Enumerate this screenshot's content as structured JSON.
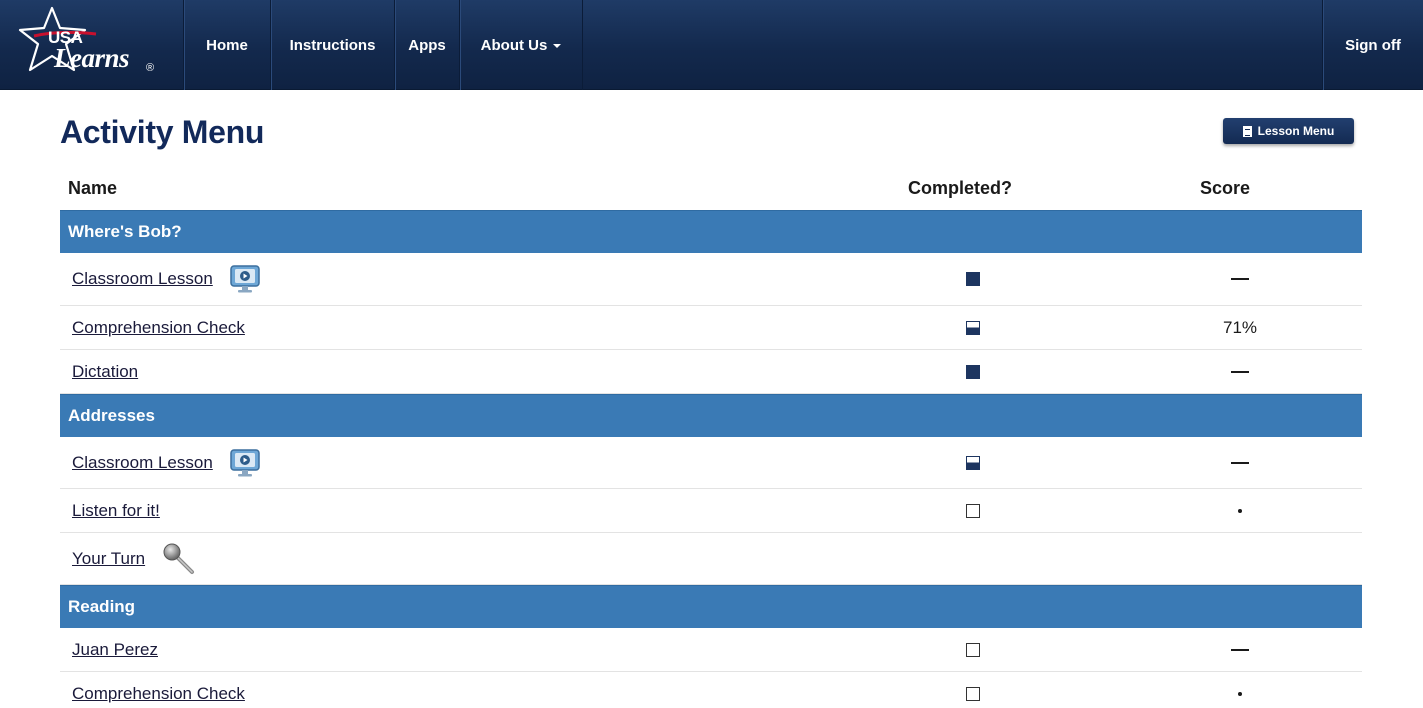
{
  "nav": {
    "logo_top": "USA",
    "logo_bottom": "Learns",
    "logo_reg": "®",
    "items": [
      {
        "label": "Home"
      },
      {
        "label": "Instructions"
      },
      {
        "label": "Apps"
      },
      {
        "label": "About Us"
      }
    ],
    "sign_off": "Sign off"
  },
  "page": {
    "title": "Activity Menu",
    "lesson_menu_button": "Lesson Menu"
  },
  "table": {
    "headers": {
      "name": "Name",
      "completed": "Completed?",
      "score": "Score"
    },
    "sections": [
      {
        "title": "Where's Bob?",
        "rows": [
          {
            "name": "Classroom Lesson",
            "icon": "video-lesson-icon",
            "completed": "full",
            "score": "—"
          },
          {
            "name": "Comprehension Check",
            "icon": "",
            "completed": "partial",
            "score": "71%"
          },
          {
            "name": "Dictation",
            "icon": "",
            "completed": "full",
            "score": "—"
          }
        ]
      },
      {
        "title": "Addresses",
        "rows": [
          {
            "name": "Classroom Lesson",
            "icon": "video-lesson-icon",
            "completed": "partial",
            "score": "—"
          },
          {
            "name": "Listen for it!",
            "icon": "",
            "completed": "empty",
            "score": "•"
          },
          {
            "name": "Your Turn",
            "icon": "microphone-icon",
            "completed": "",
            "score": ""
          }
        ]
      },
      {
        "title": "Reading",
        "rows": [
          {
            "name": "Juan Perez",
            "icon": "",
            "completed": "empty",
            "score": "—"
          },
          {
            "name": "Comprehension Check",
            "icon": "",
            "completed": "empty",
            "score": "•"
          }
        ]
      }
    ]
  },
  "colors": {
    "navbar": "#13294d",
    "section_bar": "#3a7ab5",
    "title": "#12295a",
    "status_fill": "#1d3560"
  }
}
